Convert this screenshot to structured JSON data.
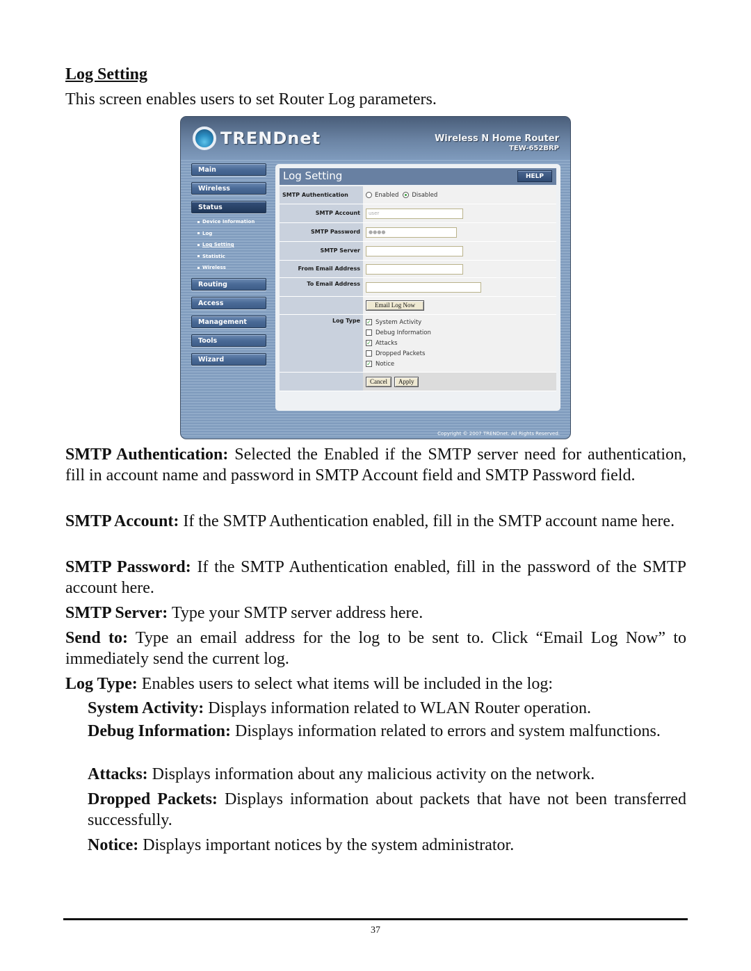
{
  "doc": {
    "title": "Log Setting",
    "intro": "This screen enables users to set Router Log parameters.",
    "page_number": "37"
  },
  "router": {
    "brand": "TRENDnet",
    "product_name": "Wireless N Home Router",
    "model": "TEW-652BRP",
    "copyright": "Copyright © 2007 TRENDnet. All Rights Reserved.",
    "nav": {
      "main": "Main",
      "wireless": "Wireless",
      "status": "Status",
      "status_sub": [
        "Device Information",
        "Log",
        "Log Setting",
        "Statistic",
        "Wireless"
      ],
      "routing": "Routing",
      "access": "Access",
      "management": "Management",
      "tools": "Tools",
      "wizard": "Wizard"
    },
    "panel": {
      "title": "Log Setting",
      "help": "HELP",
      "smtp_auth_label": "SMTP Authentication",
      "enabled": "Enabled",
      "disabled": "Disabled",
      "smtp_auth_selected": "Disabled",
      "smtp_account_label": "SMTP Account",
      "smtp_account_value": "user",
      "smtp_password_label": "SMTP Password",
      "smtp_password_value": "●●●●",
      "smtp_server_label": "SMTP Server",
      "smtp_server_value": "",
      "from_email_label": "From Email Address",
      "from_email_value": "",
      "to_email_label": "To Email Address",
      "to_email_value": "",
      "email_log_now": "Email Log Now",
      "log_type_label": "Log Type",
      "log_types": [
        {
          "label": "System Activity",
          "checked": true
        },
        {
          "label": "Debug Information",
          "checked": false
        },
        {
          "label": "Attacks",
          "checked": true
        },
        {
          "label": "Dropped Packets",
          "checked": false
        },
        {
          "label": "Notice",
          "checked": true
        }
      ],
      "cancel": "Cancel",
      "apply": "Apply"
    }
  },
  "descriptions": [
    {
      "term": "SMTP Authentication:",
      "text": " Selected the Enabled if the SMTP server need for authentication, fill in account name and password in SMTP Account field and SMTP Password field."
    },
    {
      "term": "SMTP Account:",
      "text": " If the SMTP Authentication enabled, fill in the SMTP account name here."
    },
    {
      "term": "SMTP Password:",
      "text": " If the SMTP Authentication enabled, fill in the password of the SMTP account here."
    },
    {
      "term": "SMTP Server:",
      "text": " Type your SMTP server address here."
    },
    {
      "term": "Send to:",
      "text": " Type an email address for the log to be sent to. Click “Email Log Now” to immediately send the current log."
    },
    {
      "term": "Log Type:",
      "text": " Enables users to select what items will be included in the log:"
    }
  ],
  "log_type_descriptions": [
    {
      "term": "System Activity:",
      "text": " Displays information related to WLAN Router operation."
    },
    {
      "term": "Debug Information:",
      "text": " Displays information related to errors and system malfunctions."
    },
    {
      "term": "Attacks:",
      "text": " Displays information about any malicious activity on the network."
    },
    {
      "term": "Dropped Packets:",
      "text": " Displays information about packets that have not been transferred successfully."
    },
    {
      "term": "Notice:",
      "text": " Displays important notices by the system administrator."
    }
  ]
}
